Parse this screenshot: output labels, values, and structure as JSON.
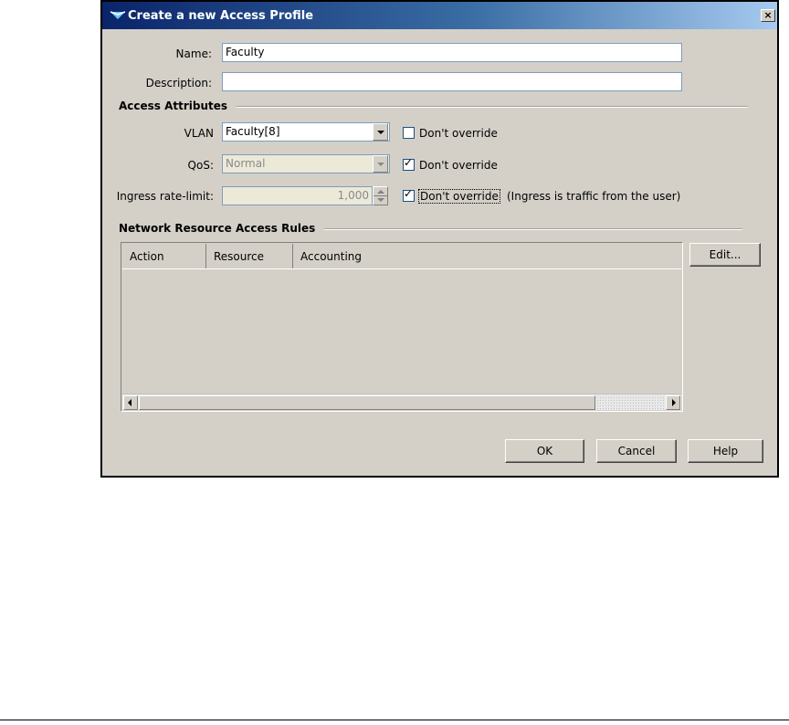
{
  "window": {
    "title": "Create a new Access Profile",
    "close_glyph": "×"
  },
  "form": {
    "name_label": "Name:",
    "name_value": "Faculty",
    "description_label": "Description:",
    "description_value": ""
  },
  "access_attributes": {
    "section_title": "Access Attributes",
    "vlan_label": "VLAN",
    "vlan_value": "Faculty[8]",
    "vlan_dont_override": {
      "label": "Don't override",
      "checked": false
    },
    "qos_label": "QoS:",
    "qos_value": "Normal",
    "qos_dont_override": {
      "label": "Don't override",
      "checked": true
    },
    "ingress_label": "Ingress rate-limit:",
    "ingress_value": "1,000",
    "ingress_dont_override": {
      "label": "Don't override",
      "checked": true
    },
    "ingress_note": "(Ingress is traffic from the user)"
  },
  "rules": {
    "section_title": "Network Resource Access Rules",
    "columns": [
      "Action",
      "Resource",
      "Accounting"
    ],
    "edit_button": "Edit..."
  },
  "buttons": {
    "ok": "OK",
    "cancel": "Cancel",
    "help": "Help"
  },
  "check_glyph": "✓",
  "colors": {
    "titlebar_start": "#0a246a",
    "titlebar_end": "#a6caf0",
    "dialog_bg": "#d4d0c8"
  }
}
